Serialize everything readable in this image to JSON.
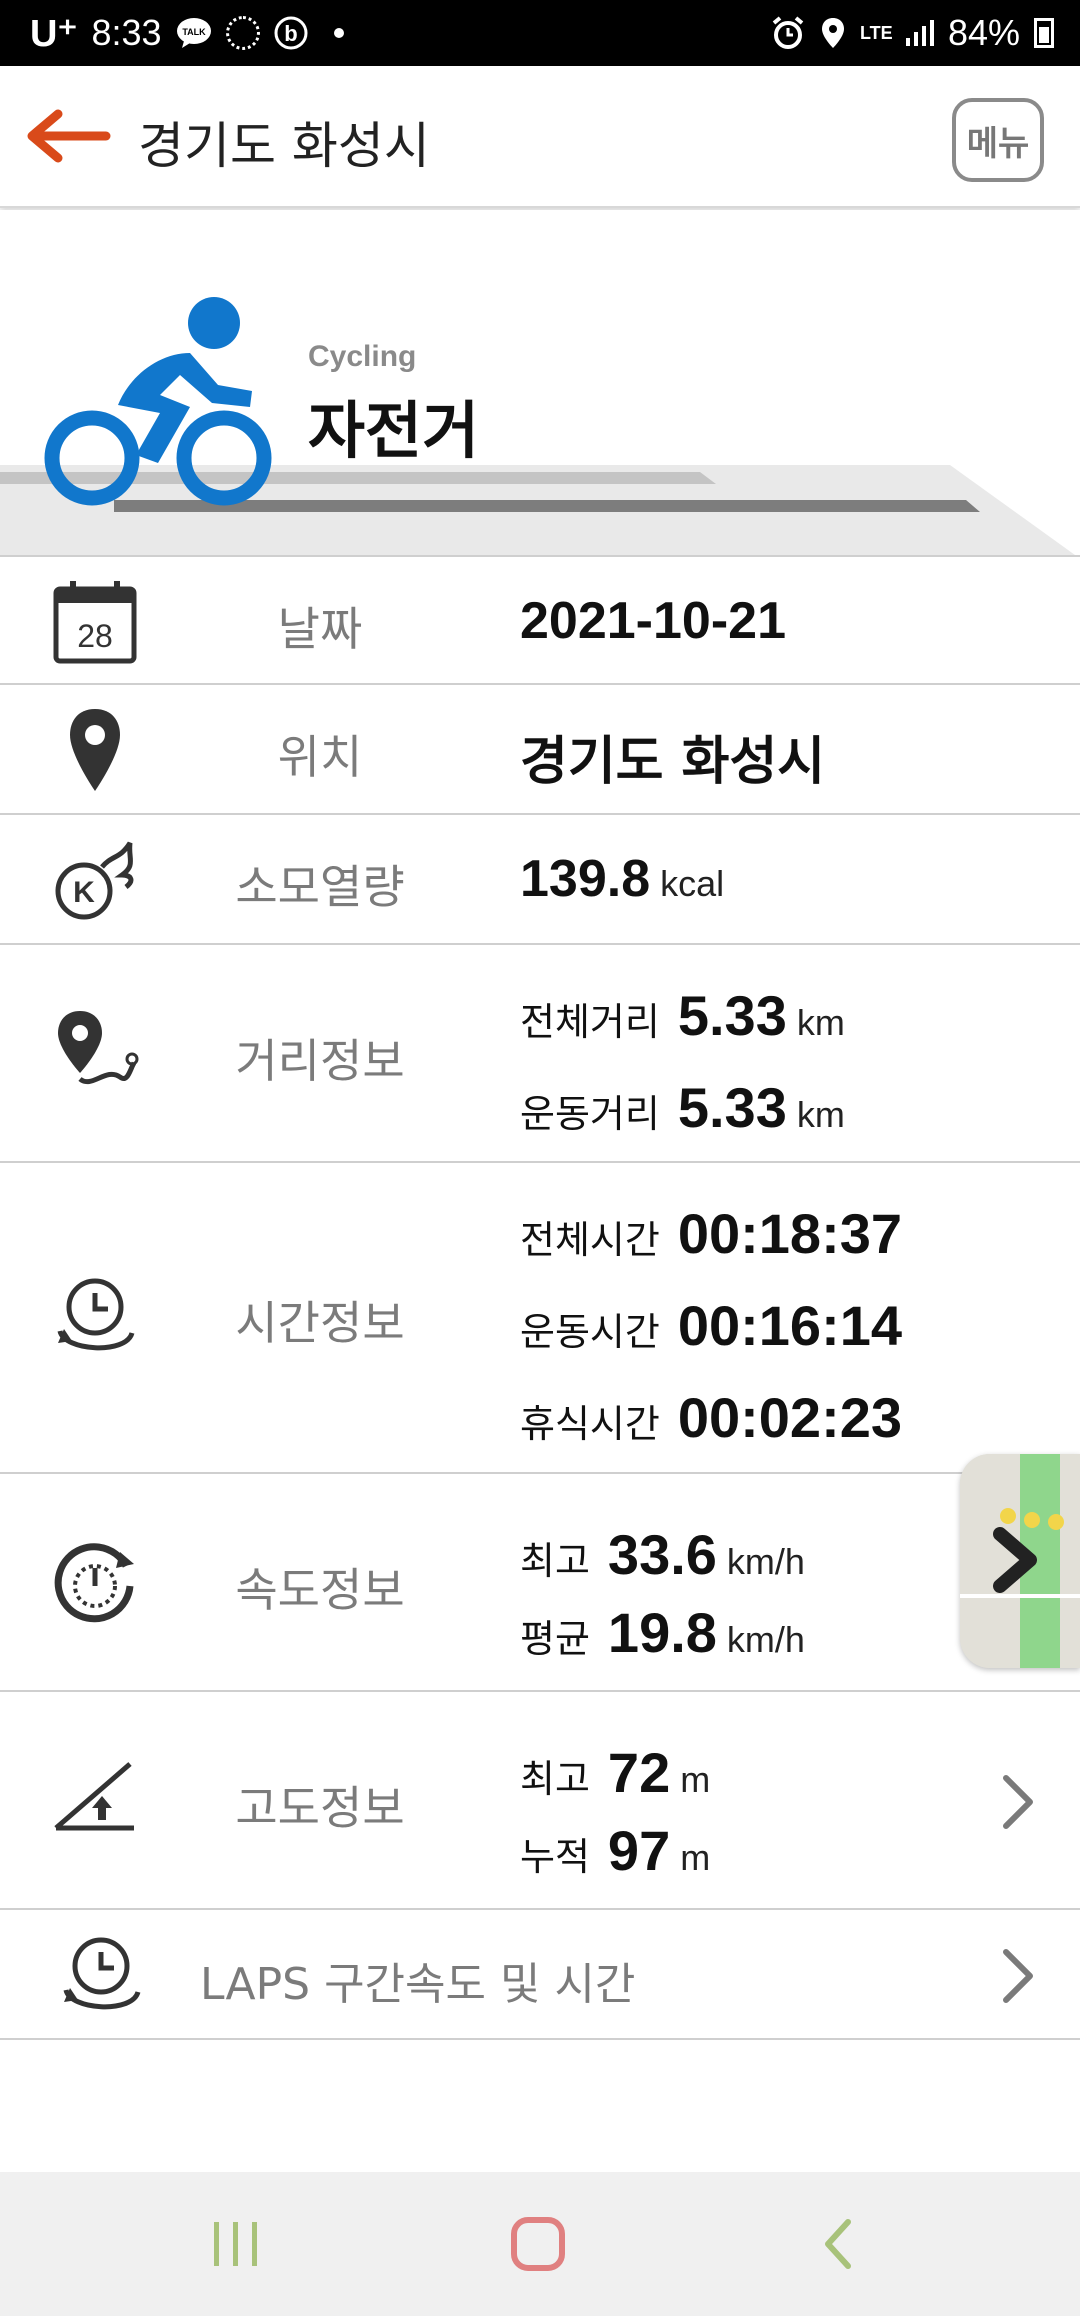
{
  "status_bar": {
    "carrier": "U⁺",
    "time": "8:33",
    "battery": "84%",
    "network": "LTE"
  },
  "header": {
    "title": "경기도 화성시",
    "menu_label": "메뉴"
  },
  "activity": {
    "sub_label": "Cycling",
    "title": "자전거",
    "icon_color": "#1177cc"
  },
  "rows": {
    "date": {
      "label": "날짜",
      "value": "2021-10-21",
      "icon_text": "28"
    },
    "location": {
      "label": "위치",
      "value": "경기도 화성시"
    },
    "calories": {
      "label": "소모열량",
      "value": "139.8",
      "unit": "kcal"
    },
    "distance": {
      "label": "거리정보",
      "total_label": "전체거리",
      "total_value": "5.33",
      "total_unit": "km",
      "moving_label": "운동거리",
      "moving_value": "5.33",
      "moving_unit": "km"
    },
    "time": {
      "label": "시간정보",
      "total_label": "전체시간",
      "total_value": "00:18:37",
      "moving_label": "운동시간",
      "moving_value": "00:16:14",
      "rest_label": "휴식시간",
      "rest_value": "00:02:23"
    },
    "speed": {
      "label": "속도정보",
      "max_label": "최고",
      "max_value": "33.6",
      "max_unit": "km/h",
      "avg_label": "평균",
      "avg_value": "19.8",
      "avg_unit": "km/h"
    },
    "altitude": {
      "label": "고도정보",
      "max_label": "최고",
      "max_value": "72",
      "max_unit": "m",
      "cum_label": "누적",
      "cum_value": "97",
      "cum_unit": "m"
    },
    "laps": {
      "label": "LAPS 구간속도 및 시간"
    }
  },
  "colors": {
    "accent": "#d94a1a",
    "label_gray": "#7b7b7b",
    "nav_recent": "#a8c27a",
    "nav_home": "#e08080",
    "nav_back": "#a8c27a"
  }
}
